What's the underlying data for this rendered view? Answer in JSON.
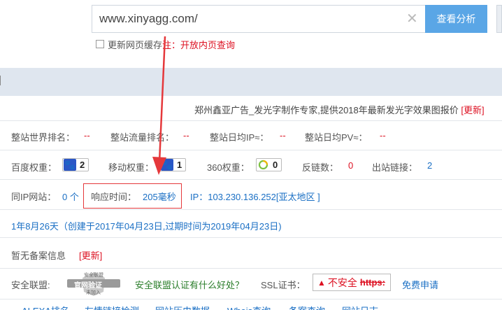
{
  "search": {
    "query": "www.xinyagg.com/",
    "submit_label": "查看分析",
    "refresh_cache_label": "更新网页缓存",
    "note_label": "注：开放内页查询"
  },
  "site_title": "郑州鑫亚广告_发光字制作专家,提供2018年最新发光字效果图报价",
  "update_label": "[更新]",
  "traffic": {
    "world_rank_label": "整站世界排名：",
    "world_rank_value": "--",
    "flow_rank_label": "整站流量排名：",
    "flow_rank_value": "--",
    "daily_ip_label": "整站日均IP≈：",
    "daily_ip_value": "--",
    "daily_pv_label": "整站日均PV≈：",
    "daily_pv_value": "--"
  },
  "weights": {
    "baidu_label": "百度权重：",
    "baidu_value": "2",
    "mobile_label": "移动权重：",
    "mobile_value": "1",
    "s360_label": "360权重：",
    "s360_value": "0",
    "backlinks_label": "反链数：",
    "backlinks_value": "0",
    "outlinks_label": "出站链接：",
    "outlinks_value": "2"
  },
  "server": {
    "same_ip_label": "同IP网站：",
    "same_ip_value": "0 个",
    "response_label": "响应时间：",
    "response_value": "205毫秒",
    "ip_text": "IP：103.230.136.252[亚太地区 ]"
  },
  "domain_age": "1年8月26天（创建于2017年04月23日,过期时间为2019年04月23日)",
  "icp": {
    "text": "暂无备案信息",
    "update_label": "[更新]"
  },
  "security": {
    "alliance_label": "安全联盟:",
    "seal_top": "安全联盟",
    "seal_main": "官网验证",
    "seal_sub": "未加入",
    "alliance_link": "安全联盟认证有什么好处？",
    "ssl_label": "SSL证书：",
    "ssl_status": "不安全",
    "ssl_proto": "https:",
    "ssl_apply": "免费申请"
  },
  "bottom_tabs": [
    "ALEXA排名",
    "友情链接检测",
    "网站历史数据",
    "Whois查询",
    "备案查询",
    "网站日志"
  ],
  "colors": {
    "accent_button": "#5aa6e6",
    "highlight_box": "#e5383b",
    "arrow": "#e5383b",
    "link": "#1a6fc4",
    "section_bar": "#dfe6ef"
  },
  "icons": [
    "close-icon",
    "baidu-paw-icon",
    "mobile-paw-icon",
    "360-ring-icon",
    "warning-icon"
  ]
}
